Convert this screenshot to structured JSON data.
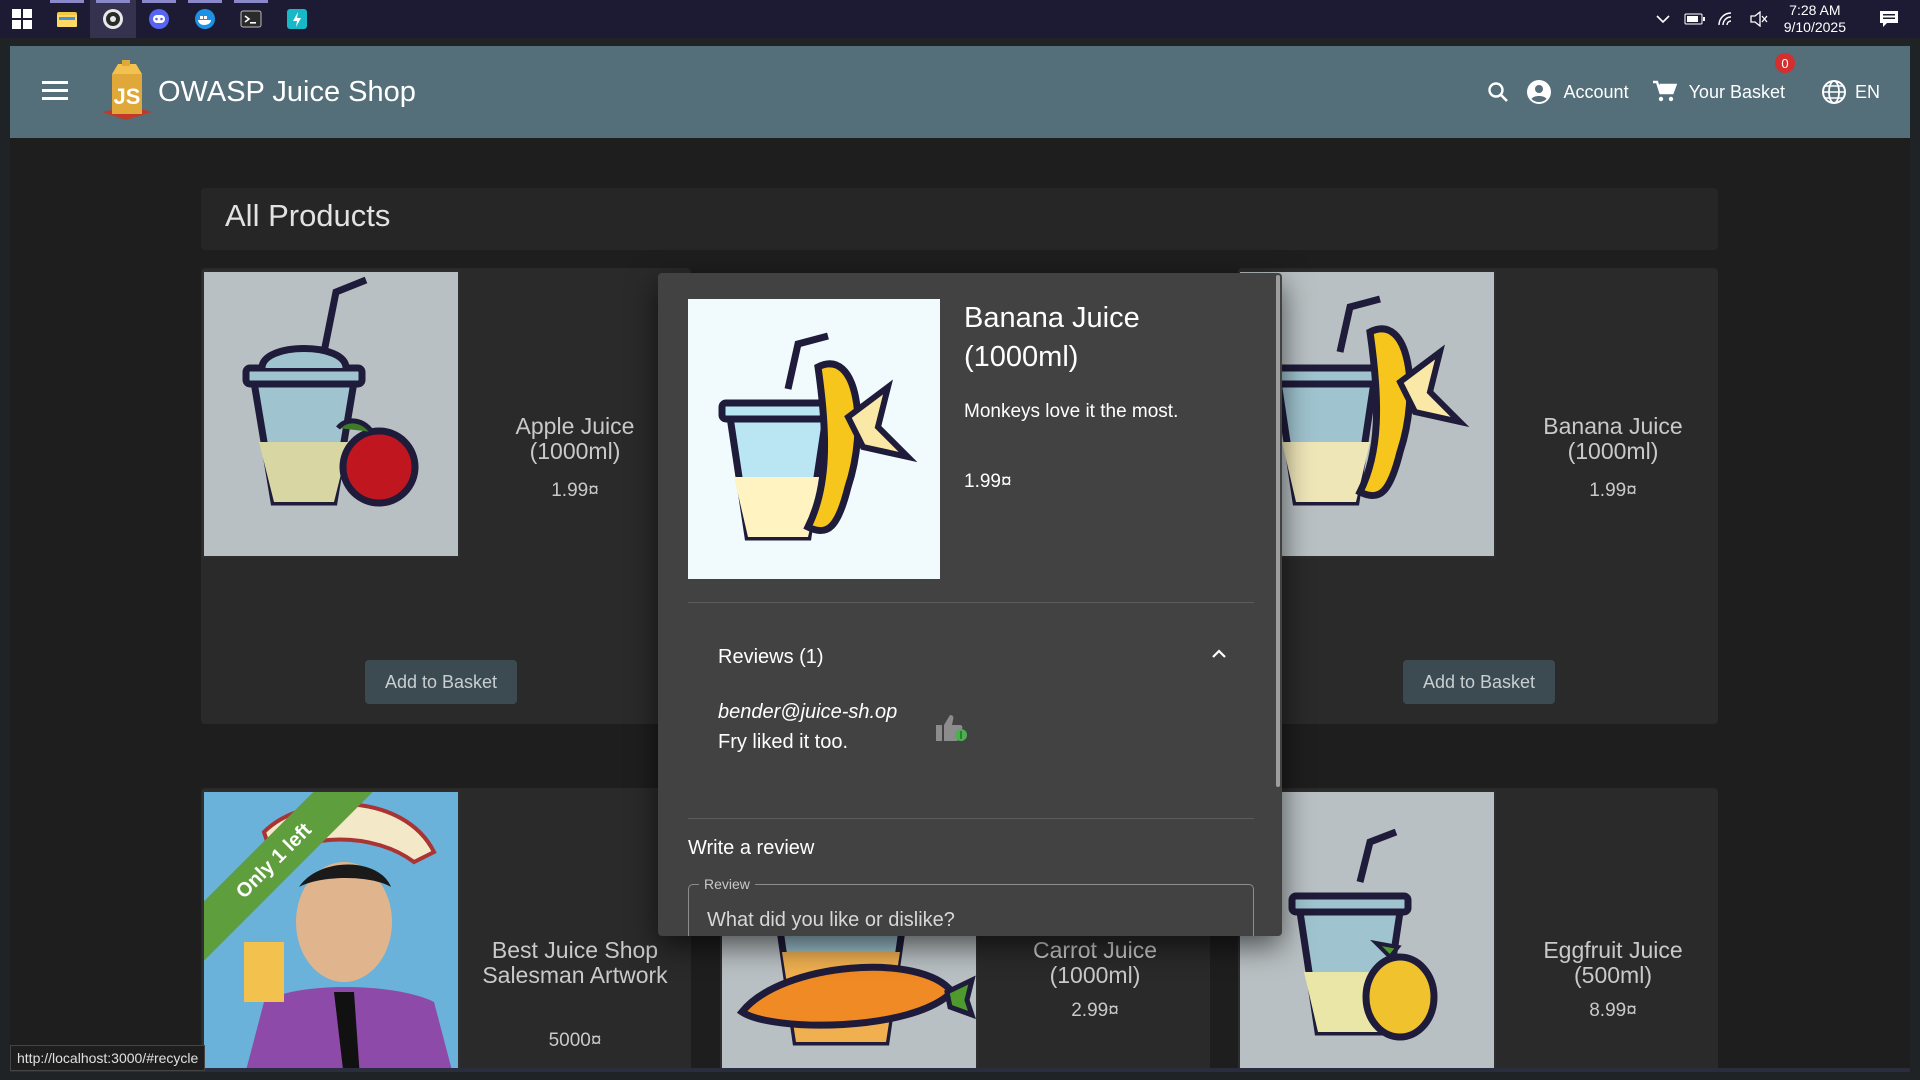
{
  "taskbar": {
    "apps": [
      {
        "name": "file-explorer-icon"
      },
      {
        "name": "obs-icon"
      },
      {
        "name": "discord-icon"
      },
      {
        "name": "docker-icon"
      },
      {
        "name": "terminal-icon"
      },
      {
        "name": "app-icon"
      }
    ],
    "time": "7:28 AM",
    "date": "9/10/2025"
  },
  "toolbar": {
    "brand": "OWASP Juice Shop",
    "account_label": "Account",
    "basket_label": "Your Basket",
    "basket_count": "0",
    "language": "EN"
  },
  "page": {
    "heading": "All Products"
  },
  "products": [
    {
      "name": "Apple Juice (1000ml)",
      "price": "1.99¤",
      "button": "Add to Basket"
    },
    {
      "name": "Banana Juice (1000ml)",
      "price": "1.99¤",
      "button": "Add to Basket"
    },
    {
      "name": "Best Juice Shop Salesman Artwork",
      "price": "5000¤",
      "ribbon": "Only 1 left"
    },
    {
      "name": "Carrot Juice (1000ml)",
      "price": "2.99¤"
    },
    {
      "name": "Eggfruit Juice (500ml)",
      "price": "8.99¤"
    }
  ],
  "dialog": {
    "title": "Banana Juice (1000ml)",
    "description": "Monkeys love it the most.",
    "price": "1.99¤",
    "reviews_header": "Reviews (1)",
    "reviews": [
      {
        "author": "bender@juice-sh.op",
        "text": "Fry liked it too."
      }
    ],
    "write_review": "Write a review",
    "review_label": "Review",
    "review_placeholder": "What did you like or dislike?"
  },
  "status_bar": {
    "url": "http://localhost:3000/#recycle"
  },
  "colors": {
    "toolbar": "#546e7a",
    "dialog": "#424242",
    "badge": "#d32f2f"
  }
}
